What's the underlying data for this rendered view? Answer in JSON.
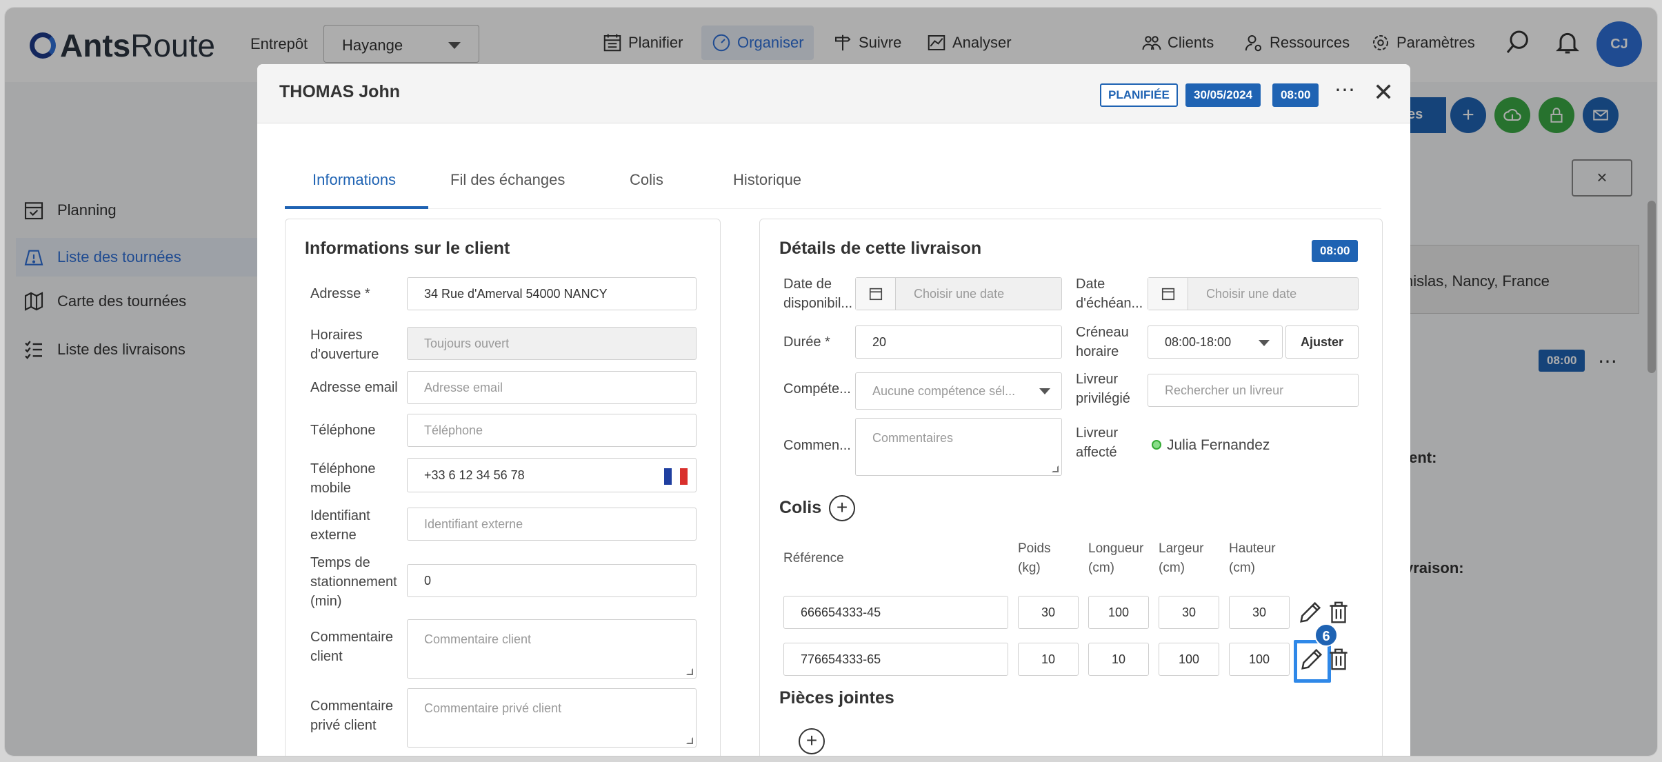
{
  "app": {
    "logo_bold": "Ants",
    "logo_light": "Route",
    "entrepot_label": "Entrepôt",
    "entrepot_value": "Hayange",
    "nav": [
      "Planifier",
      "Organiser",
      "Suivre",
      "Analyser"
    ],
    "nav_right": [
      "Clients",
      "Ressources",
      "Paramètres"
    ],
    "avatar": "CJ",
    "accent": "#1f63b3"
  },
  "sidebar": {
    "items": [
      {
        "label": "Planning",
        "icon": "calendar-icon"
      },
      {
        "label": "Liste des tournées",
        "icon": "route-list-icon"
      },
      {
        "label": "Carte des tournées",
        "icon": "map-icon"
      },
      {
        "label": "Liste des livraisons",
        "icon": "list-icon"
      }
    ]
  },
  "background": {
    "chip_text": "es",
    "address_fragment": "nislas, Nancy, France",
    "time_chip": "08:00",
    "label_client": "ient:",
    "label_livraison": "vraison:",
    "close_symbol": "×",
    "ellipsis": "⋯"
  },
  "modal": {
    "title": "THOMAS John",
    "status": "PLANIFIÉE",
    "date": "30/05/2024",
    "time": "08:00",
    "more": "⋯",
    "close": "✕",
    "tabs": [
      "Informations",
      "Fil des échanges",
      "Colis",
      "Historique"
    ]
  },
  "client": {
    "title": "Informations sur le client",
    "fields": {
      "adresse_label": "Adresse *",
      "adresse_value": "34 Rue d'Amerval 54000 NANCY",
      "horaires_label": "Horaires d'ouverture",
      "horaires_placeholder": "Toujours ouvert",
      "email_label": "Adresse email",
      "email_placeholder": "Adresse email",
      "tel_label": "Téléphone",
      "tel_placeholder": "Téléphone",
      "mobile_label": "Téléphone mobile",
      "mobile_value": "+33 6 12 34 56 78",
      "ident_label": "Identifiant externe",
      "ident_placeholder": "Identifiant externe",
      "stationnement_label": "Temps de stationnement (min)",
      "stationnement_value": "0",
      "comment_label": "Commentaire client",
      "comment_placeholder": "Commentaire client",
      "prive_label": "Commentaire privé client",
      "prive_placeholder": "Commentaire privé client"
    }
  },
  "delivery": {
    "title": "Détails de cette livraison",
    "time_badge": "08:00",
    "dispo_label": "Date de disponibil...",
    "dispo_placeholder": "Choisir une date",
    "echeance_label": "Date d'échéan...",
    "echeance_placeholder": "Choisir une date",
    "duree_label": "Durée *",
    "duree_value": "20",
    "creneau_label": "Créneau horaire",
    "creneau_value": "08:00-18:00",
    "ajuster": "Ajuster",
    "competence_label": "Compéte...",
    "competence_value": "Aucune compétence sél...",
    "livreur_pref_label": "Livreur privilégié",
    "livreur_pref_placeholder": "Rechercher un livreur",
    "comment_label": "Commen...",
    "comment_placeholder": "Commentaires",
    "livreur_aff_label": "Livreur affecté",
    "livreur_aff_value": "Julia Fernandez",
    "colis_title": "Colis",
    "pieces_title": "Pièces jointes",
    "headers": [
      "Référence",
      "Poids (kg)",
      "Longueur (cm)",
      "Largeur (cm)",
      "Hauteur (cm)"
    ],
    "rows": [
      {
        "ref": "666654333-45",
        "poids": "30",
        "longueur": "100",
        "largeur": "30",
        "hauteur": "30"
      },
      {
        "ref": "776654333-65",
        "poids": "10",
        "longueur": "10",
        "largeur": "100",
        "hauteur": "100"
      }
    ],
    "step_badge": "6"
  }
}
